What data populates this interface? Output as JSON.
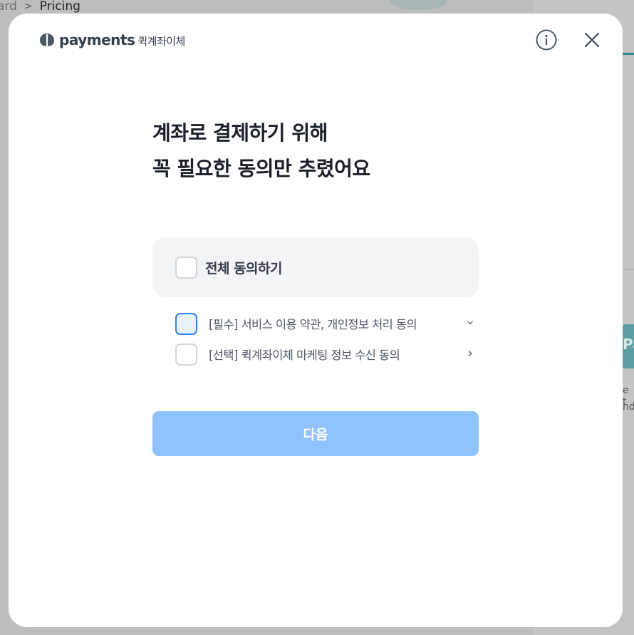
{
  "background": {
    "breadcrumb_prev": "ard",
    "breadcrumb_sep": ">",
    "breadcrumb_current": "Pricing",
    "right_button_fragment": "Pa",
    "right_text_fragment_1": "e t",
    "right_text_fragment_2": "nd"
  },
  "modal": {
    "brand": {
      "name": "payments",
      "subtitle": "퀵계좌이체"
    },
    "icons": {
      "info": "info-icon",
      "close": "close-icon"
    },
    "headline": {
      "line1": "계좌로 결제하기 위해",
      "line2": "꼭 필요한 동의만 추렸어요"
    },
    "agree_all": {
      "label": "전체 동의하기",
      "checked": false
    },
    "terms": [
      {
        "label": "[필수] 서비스 이용 약관, 개인정보 처리 동의",
        "checked": false,
        "chevron": "chevron-down-icon"
      },
      {
        "label": "[선택] 퀵계좌이체 마케팅 정보 수신 동의",
        "checked": false,
        "chevron": "chevron-right-icon"
      }
    ],
    "next_button": {
      "label": "다음",
      "enabled": false
    }
  },
  "colors": {
    "primary_disabled": "#90c2ff",
    "primary": "#3182f6",
    "text_strong": "#191f28",
    "text_body": "#4e5968",
    "surface": "#f2f4f6"
  }
}
